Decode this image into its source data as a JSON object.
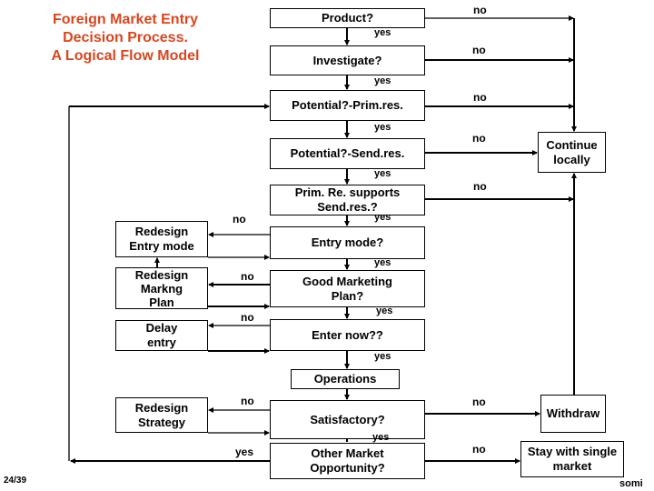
{
  "title": {
    "line1": "Foreign Market Entry",
    "line2": "Decision Process.",
    "line3": "A Logical Flow Model",
    "color": "#d9461e"
  },
  "nodes": {
    "product": "Product?",
    "investigate": "Investigate?",
    "potential_prim": "Potential?-Prim.res.",
    "potential_send": "Potential?-Send.res.",
    "prim_supports_1": "Prim. Re. supports",
    "prim_supports_2": "Send.res.?",
    "entry_mode": "Entry mode?",
    "good_marketing_1": "Good Marketing",
    "good_marketing_2": "Plan?",
    "enter_now": "Enter now??",
    "operations": "Operations",
    "satisfactory": "Satisfactory?",
    "other_market_1": "Other Market",
    "other_market_2": "Opportunity?",
    "redesign_entry_1": "Redesign",
    "redesign_entry_2": "Entry mode",
    "redesign_marketing_1": "Redesign",
    "redesign_marketing_2": "Markng",
    "redesign_marketing_3": "Plan",
    "delay_entry_1": "Delay",
    "delay_entry_2": "entry",
    "redesign_strategy_1": "Redesign",
    "redesign_strategy_2": "Strategy",
    "continue_locally_1": "Continue",
    "continue_locally_2": "locally",
    "withdraw": "Withdraw",
    "stay_single_1": "Stay with single",
    "stay_single_2": "market"
  },
  "edge_labels": {
    "yes": "yes",
    "no": "no"
  },
  "footer": {
    "page": "24/39",
    "author": "somi"
  }
}
